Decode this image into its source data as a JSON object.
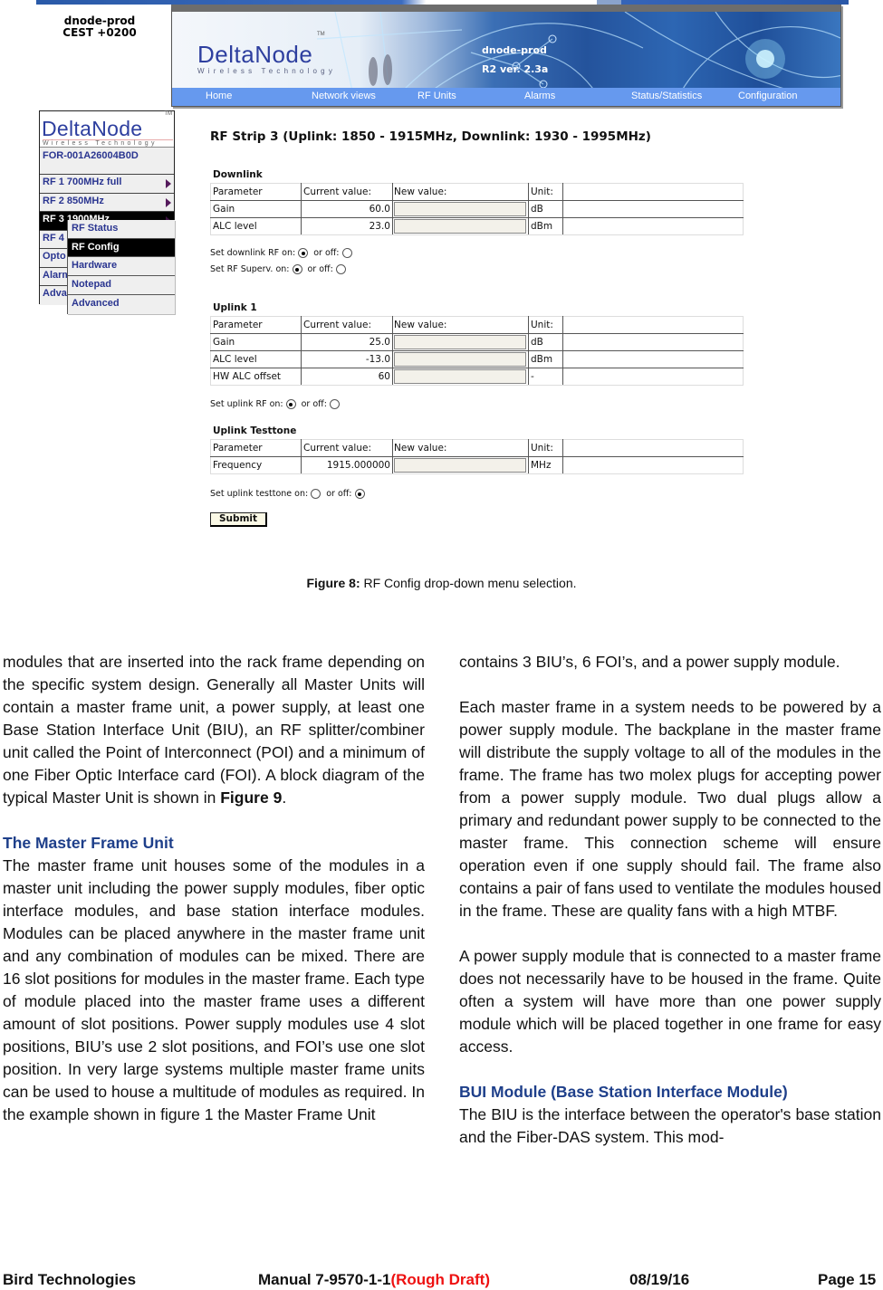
{
  "figure": {
    "host_info": {
      "hostname": "dnode-prod",
      "timezone": "CEST +0200"
    },
    "banner": {
      "logo": "DeltaNode",
      "logo_subtitle": "Wireless Technology",
      "trademark": "TM",
      "hostname": "dnode-prod",
      "version": "R2 ver. 2.3a"
    },
    "nav": [
      {
        "label": "Home"
      },
      {
        "label": "Network views"
      },
      {
        "label": "RF Units"
      },
      {
        "label": "Alarms"
      },
      {
        "label": "Status/Statistics"
      },
      {
        "label": "Configuration"
      }
    ],
    "side_menu": {
      "logo": "DeltaNode",
      "logo_subtitle": "Wireless Technology",
      "trademark": "TM",
      "unit_id": "FOR-001A26004B0D",
      "items": [
        {
          "label": "RF 1 700MHz full",
          "has_submenu": true
        },
        {
          "label": "RF 2 850MHz",
          "has_submenu": true
        },
        {
          "label": "RF 3 1900MHz",
          "has_submenu": true,
          "active": true
        },
        {
          "label": "RF 4",
          "has_submenu": false
        },
        {
          "label": "Opto",
          "has_submenu": false
        },
        {
          "label": "Alarm",
          "has_submenu": false
        },
        {
          "label": "Adva",
          "has_submenu": false
        }
      ],
      "submenu": [
        {
          "label": "RF Status"
        },
        {
          "label": "RF Config",
          "active": true
        },
        {
          "label": "Hardware"
        },
        {
          "label": "Notepad"
        },
        {
          "label": "Advanced"
        }
      ]
    },
    "page": {
      "title": "RF Strip  3 (Uplink:  1850 - 1915MHz, Downlink:  1930 - 1995MHz)",
      "columns": [
        "Parameter",
        "Current value:",
        "New value:",
        "Unit:"
      ],
      "downlink": {
        "title": "Downlink",
        "rows": [
          {
            "parameter": "Gain",
            "current": "60.0",
            "new_value": "",
            "unit": "dB"
          },
          {
            "parameter": "ALC level",
            "current": "23.0",
            "new_value": "",
            "unit": "dBm"
          }
        ],
        "toggles": [
          {
            "label": "Set downlink RF on:",
            "off_label": "or off:",
            "state": "on"
          },
          {
            "label": "Set RF Superv. on:",
            "off_label": "or off:",
            "state": "on"
          }
        ]
      },
      "uplink": {
        "title": "Uplink 1",
        "rows": [
          {
            "parameter": "Gain",
            "current": "25.0",
            "new_value": "",
            "unit": "dB"
          },
          {
            "parameter": "ALC level",
            "current": "-13.0",
            "new_value": "",
            "unit": "dBm"
          },
          {
            "parameter": "HW ALC offset",
            "current": "60",
            "new_value": "",
            "unit": "-"
          }
        ],
        "toggles": [
          {
            "label": "Set uplink RF on:",
            "off_label": "or off:",
            "state": "on"
          }
        ]
      },
      "testtone": {
        "title": "Uplink Testtone",
        "rows": [
          {
            "parameter": "Frequency",
            "current": "1915.000000",
            "new_value": "",
            "unit": "MHz"
          }
        ],
        "toggles": [
          {
            "label": "Set uplink testtone on:",
            "off_label": "or off:",
            "state": "off"
          }
        ]
      },
      "submit_label": "Submit"
    },
    "caption": {
      "label": "Figure 8:",
      "text": " RF Config drop-down menu selection."
    }
  },
  "document": {
    "left_column": {
      "para1": "modules that are inserted into the rack frame depending on the specific system design. Generally all Master Units will contain a master frame unit, a power supply, at least one Base Station Interface Unit (BIU), an RF splitter/combiner unit called the Point of Interconnect (POI) and a minimum of one Fiber Optic Interface card (FOI). A block diagram of the typical Master Unit is shown in ",
      "para1_ref": "Figure 9",
      "para1_end": ".",
      "heading": "The Master Frame Unit",
      "para2": "The master frame unit houses some of the modules in a master unit including the power supply modules, fiber optic interface modules, and base station interface modules. Modules can be placed anywhere in the master frame unit and any combination of modules can be mixed. There are 16 slot positions for modules in the master frame. Each type of module placed into the master frame uses a different amount of slot positions. Power supply modules use 4 slot positions, BIU’s use 2 slot positions, and FOI’s use one slot position. In very large systems multiple master frame units can be used to house a multitude of modules as required. In the example shown in figure 1 the Master Frame Unit"
    },
    "right_column": {
      "para1": "contains 3 BIU’s, 6 FOI’s, and a power supply module.",
      "para2": "Each master frame in a system needs to be powered by a power supply module. The backplane in the master frame will distribute the supply voltage to all of the modules in the frame. The frame has two molex plugs for accepting power from a power supply module. Two dual plugs allow a primary and redundant power supply to be connected to the master frame. This connection scheme will ensure operation even if one supply should fail. The frame also contains a pair of fans used to ventilate the modules housed in the frame. These are quality fans with a high MTBF.",
      "para3": "A power supply module that is connected to a master frame does not necessarily have to be housed in the frame. Quite often a system will have more than one power supply module which will be placed together in one frame for easy access.",
      "heading": "BUI Module (Base Station Interface Module)",
      "para4": "The BIU is the interface between the operator's base station and the Fiber-DAS system. This mod-"
    }
  },
  "footer": {
    "company": "Bird Technologies",
    "manual": "Manual 7-9570-1-1",
    "draft": "(Rough Draft)",
    "date": "08/19/16",
    "page": "Page 15"
  },
  "colors": {
    "heading_blue": "#1e3f8a",
    "nav_blue": "#6699ee",
    "draft_red": "#ee1111",
    "menu_text": "#2a3590"
  }
}
